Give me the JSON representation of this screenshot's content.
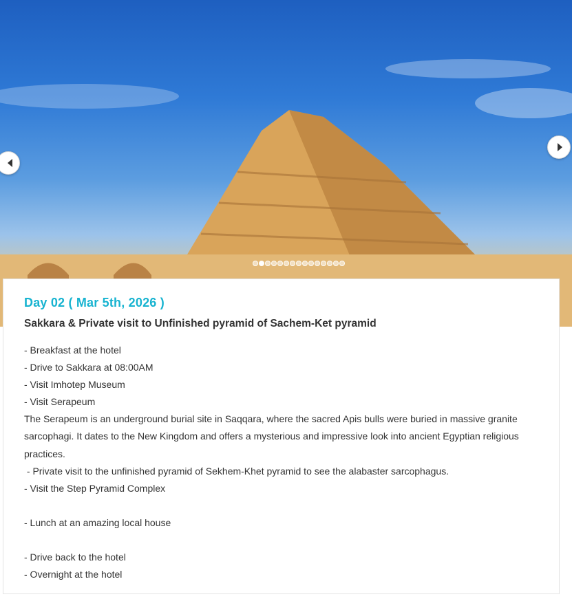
{
  "hero": {
    "image": "step-pyramid-of-djoser-photo",
    "slide_count": 15,
    "active_slide": 2,
    "prev_icon": "chevron-left-icon",
    "next_icon": "chevron-right-icon"
  },
  "itinerary": {
    "day_title": "Day 02 ( Mar 5th, 2026 )",
    "subtitle": "Sakkara & Private visit to Unfinished pyramid of Sachem-Ket pyramid",
    "lines": [
      "- Breakfast at the hotel",
      "- Drive to Sakkara at 08:00AM",
      "- Visit Imhotep Museum",
      "- Visit Serapeum",
      "The Serapeum is an underground burial site in Saqqara, where the sacred Apis bulls were buried in massive granite sarcophagi. It dates to the New Kingdom and offers a mysterious and impressive look into ancient Egyptian religious practices.",
      " - Private visit to the unfinished pyramid of Sekhem-Khet pyramid to see the alabaster sarcophagus.",
      "- Visit the Step Pyramid Complex",
      "",
      "- Lunch at an amazing local house",
      "",
      "- Drive back to the hotel",
      "- Overnight at the hotel"
    ]
  },
  "colors": {
    "accent": "#17b3d0",
    "text": "#333333"
  }
}
